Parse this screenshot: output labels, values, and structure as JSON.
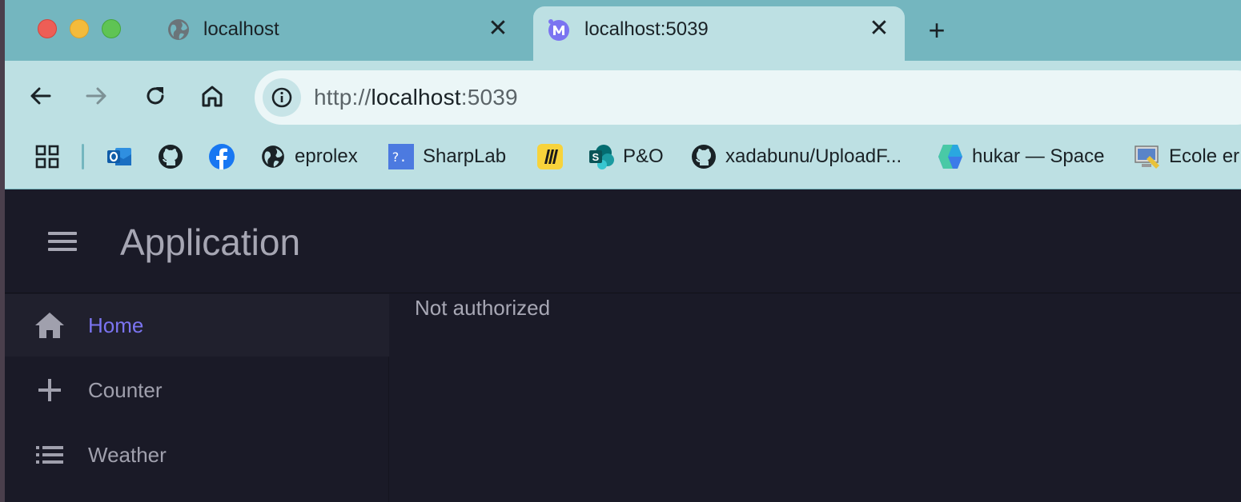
{
  "browser": {
    "tabs": [
      {
        "title": "localhost",
        "favicon": "globe-icon",
        "active": false
      },
      {
        "title": "localhost:5039",
        "favicon": "mudblazor-icon",
        "active": true
      }
    ],
    "close_glyph": "✕",
    "new_tab_glyph": "+",
    "address": {
      "scheme": "http://",
      "host": "localhost",
      "port": ":5039"
    },
    "bookmarks": [
      {
        "label": "",
        "icon": "outlook-icon"
      },
      {
        "label": "",
        "icon": "github-icon"
      },
      {
        "label": "",
        "icon": "facebook-icon"
      },
      {
        "label": "eprolex",
        "icon": "globe-icon"
      },
      {
        "label": "SharpLab",
        "icon": "sharplab-icon"
      },
      {
        "label": "",
        "icon": "miro-icon"
      },
      {
        "label": "P&O",
        "icon": "sharepoint-icon"
      },
      {
        "label": "xadabunu/UploadF...",
        "icon": "github-icon"
      },
      {
        "label": "hukar — Space",
        "icon": "space-icon"
      },
      {
        "label": "Ecole er",
        "icon": "monitor-icon"
      }
    ]
  },
  "app": {
    "title": "Application",
    "nav": [
      {
        "label": "Home",
        "icon": "home-icon",
        "active": true
      },
      {
        "label": "Counter",
        "icon": "plus-icon",
        "active": false
      },
      {
        "label": "Weather",
        "icon": "list-icon",
        "active": false
      }
    ],
    "content_message": "Not authorized"
  },
  "colors": {
    "tabstrip": "#74b6bf",
    "toolbar": "#bde0e3",
    "app_background": "#1a1a27",
    "nav_active": "#7b74f1"
  }
}
